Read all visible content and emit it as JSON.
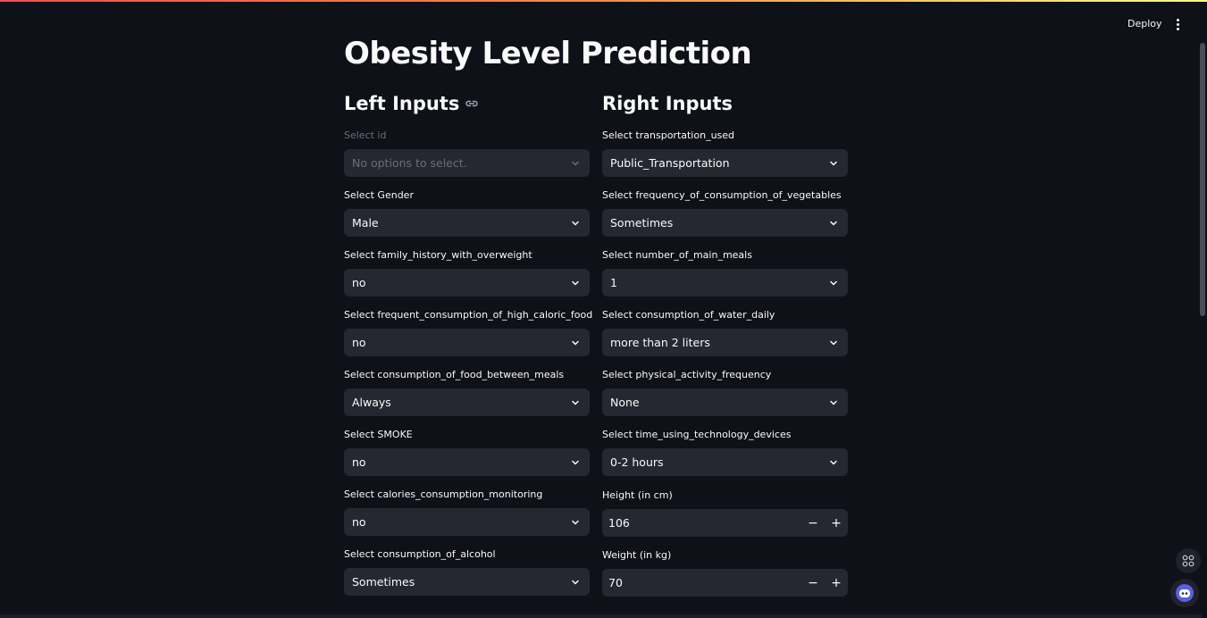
{
  "header": {
    "deploy_label": "Deploy"
  },
  "page": {
    "title": "Obesity Level Prediction",
    "left_heading": "Left Inputs",
    "right_heading": "Right Inputs"
  },
  "left": [
    {
      "label": "Select id",
      "value": "No options to select.",
      "disabled": true
    },
    {
      "label": "Select Gender",
      "value": "Male"
    },
    {
      "label": "Select family_history_with_overweight",
      "value": "no"
    },
    {
      "label": "Select frequent_consumption_of_high_caloric_food",
      "value": "no"
    },
    {
      "label": "Select consumption_of_food_between_meals",
      "value": "Always"
    },
    {
      "label": "Select SMOKE",
      "value": "no"
    },
    {
      "label": "Select calories_consumption_monitoring",
      "value": "no"
    },
    {
      "label": "Select consumption_of_alcohol",
      "value": "Sometimes"
    }
  ],
  "right": [
    {
      "label": "Select transportation_used",
      "value": "Public_Transportation"
    },
    {
      "label": "Select frequency_of_consumption_of_vegetables",
      "value": "Sometimes"
    },
    {
      "label": "Select number_of_main_meals",
      "value": "1"
    },
    {
      "label": "Select consumption_of_water_daily",
      "value": "more than 2 liters"
    },
    {
      "label": "Select physical_activity_frequency",
      "value": "None"
    },
    {
      "label": "Select time_using_technology_devices",
      "value": "0-2 hours"
    }
  ],
  "height": {
    "label": "Height (in cm)",
    "value": "106",
    "minus": "−",
    "plus": "+"
  },
  "weight": {
    "label": "Weight (in kg)",
    "value": "70",
    "minus": "−",
    "plus": "+"
  },
  "colors": {
    "background": "#0e1117",
    "input": "#262730",
    "accent": "#ff4b4b"
  },
  "icons": [
    "link-icon",
    "chevron-down-icon",
    "kebab-menu-icon",
    "apps-grid-icon",
    "chat-bot-icon"
  ]
}
